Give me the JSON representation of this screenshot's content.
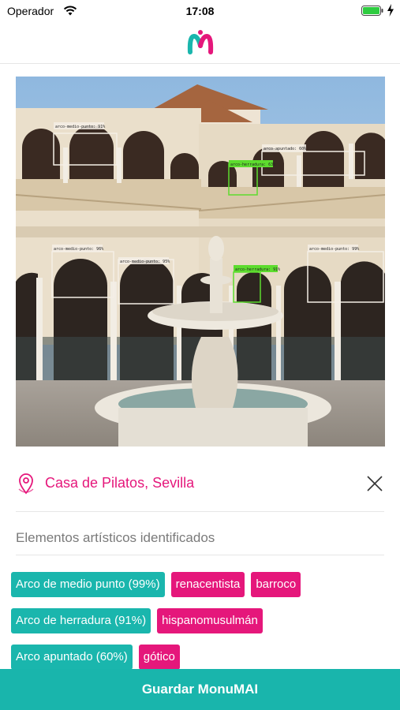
{
  "status_bar": {
    "carrier": "Operador",
    "time": "17:08"
  },
  "colors": {
    "accent": "#19b5ac",
    "brand_pink": "#e5177b",
    "teal_tag": "#1ab6ad",
    "pink_tag": "#e5177b"
  },
  "photo": {
    "detections": [
      {
        "label": "arco-medio-punto: 91%",
        "kind": "medio-punto"
      },
      {
        "label": "arco-apuntado: 60%",
        "kind": "apuntado"
      },
      {
        "label": "arco-herradura: 63%",
        "kind": "herradura"
      },
      {
        "label": "arco-medio-punto: 96%",
        "kind": "medio-punto"
      },
      {
        "label": "arco-medio-punto: 95%",
        "kind": "medio-punto"
      },
      {
        "label": "arco-herradura: 91%",
        "kind": "herradura"
      },
      {
        "label": "arco-medio-punto: 99%",
        "kind": "medio-punto"
      }
    ]
  },
  "location": {
    "icon": "location-pin-icon",
    "title": "Casa de Pilatos, Sevilla"
  },
  "section_title": "Elementos artísticos identificados",
  "tag_rows": [
    [
      {
        "label": "Arco de medio punto (99%)",
        "style": "teal"
      },
      {
        "label": "renacentista",
        "style": "pink"
      },
      {
        "label": "barroco",
        "style": "pink"
      }
    ],
    [
      {
        "label": "Arco de herradura (91%)",
        "style": "teal"
      },
      {
        "label": "hispanomusulmán",
        "style": "pink"
      }
    ],
    [
      {
        "label": "Arco apuntado (60%)",
        "style": "teal"
      },
      {
        "label": "gótico",
        "style": "pink"
      }
    ]
  ],
  "save_button": "Guardar MonuMAI"
}
